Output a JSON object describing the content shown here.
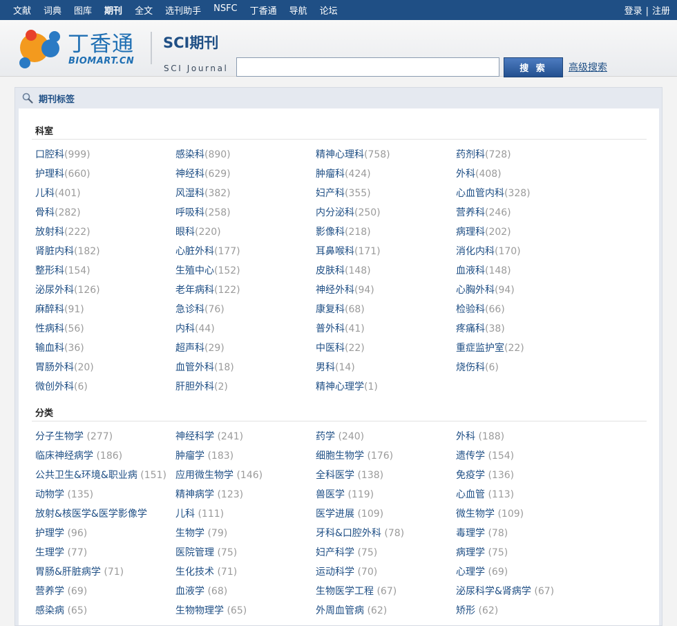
{
  "topnav": {
    "items": [
      "文献",
      "词典",
      "图库",
      "期刊",
      "全文",
      "选刊助手",
      "NSFC",
      "丁香通",
      "导航",
      "论坛"
    ],
    "active": "期刊",
    "login": "登录",
    "separator": "|",
    "register": "注册"
  },
  "header": {
    "logo_text": "丁香通",
    "logo_sub": "BIOMART.CN",
    "sci_title": "SCI期刊",
    "sci_sub": "SCI Journal",
    "search_value": "",
    "search_button": "搜 索",
    "advanced_search": "高级搜索"
  },
  "panel": {
    "title": "期刊标签",
    "sections": [
      {
        "title": "科室",
        "entries": [
          [
            "口腔科",
            "(999)"
          ],
          [
            "感染科",
            "(890)"
          ],
          [
            "精神心理科",
            "(758)"
          ],
          [
            "药剂科",
            "(728)"
          ],
          [
            "护理科",
            "(660)"
          ],
          [
            "神经科",
            "(629)"
          ],
          [
            "肿瘤科",
            "(424)"
          ],
          [
            "外科",
            "(408)"
          ],
          [
            "儿科",
            "(401)"
          ],
          [
            "风湿科",
            "(382)"
          ],
          [
            "妇产科",
            "(355)"
          ],
          [
            "心血管内科",
            "(328)"
          ],
          [
            "骨科",
            "(282)"
          ],
          [
            "呼吸科",
            "(258)"
          ],
          [
            "内分泌科",
            "(250)"
          ],
          [
            "营养科",
            "(246)"
          ],
          [
            "放射科",
            "(222)"
          ],
          [
            "眼科",
            "(220)"
          ],
          [
            "影像科",
            "(218)"
          ],
          [
            "病理科",
            "(202)"
          ],
          [
            "肾脏内科",
            "(182)"
          ],
          [
            "心脏外科",
            "(177)"
          ],
          [
            "耳鼻喉科",
            "(171)"
          ],
          [
            "消化内科",
            "(170)"
          ],
          [
            "整形科",
            "(154)"
          ],
          [
            "生殖中心",
            "(152)"
          ],
          [
            "皮肤科",
            "(148)"
          ],
          [
            "血液科",
            "(148)"
          ],
          [
            "泌尿外科",
            "(126)"
          ],
          [
            "老年病科",
            "(122)"
          ],
          [
            "神经外科",
            "(94)"
          ],
          [
            "心胸外科",
            "(94)"
          ],
          [
            "麻醉科",
            "(91)"
          ],
          [
            "急诊科",
            "(76)"
          ],
          [
            "康复科",
            "(68)"
          ],
          [
            "检验科",
            "(66)"
          ],
          [
            "性病科",
            "(56)"
          ],
          [
            "内科",
            "(44)"
          ],
          [
            "普外科",
            "(41)"
          ],
          [
            "疼痛科",
            "(38)"
          ],
          [
            "输血科",
            "(36)"
          ],
          [
            "超声科",
            "(29)"
          ],
          [
            "中医科",
            "(22)"
          ],
          [
            "重症监护室",
            "(22)"
          ],
          [
            "胃肠外科",
            "(20)"
          ],
          [
            "血管外科",
            "(18)"
          ],
          [
            "男科",
            "(14)"
          ],
          [
            "烧伤科",
            "(6)"
          ],
          [
            "微创外科",
            "(6)"
          ],
          [
            "肝胆外科",
            "(2)"
          ],
          [
            "精神心理学",
            "(1)"
          ]
        ]
      },
      {
        "title": "分类",
        "entries": [
          [
            "分子生物学",
            " (277)"
          ],
          [
            "神经科学",
            " (241)"
          ],
          [
            "药学",
            " (240)"
          ],
          [
            "外科",
            " (188)"
          ],
          [
            "临床神经病学",
            " (186)"
          ],
          [
            "肿瘤学",
            " (183)"
          ],
          [
            "细胞生物学",
            " (176)"
          ],
          [
            "遗传学",
            " (154)"
          ],
          [
            "公共卫生&环境&职业病",
            " (151)"
          ],
          [
            "应用微生物学",
            " (146)"
          ],
          [
            "全科医学",
            " (138)"
          ],
          [
            "免疫学",
            " (136)"
          ],
          [
            "动物学",
            " (135)"
          ],
          [
            "精神病学",
            " (123)"
          ],
          [
            "兽医学",
            " (119)"
          ],
          [
            "心血管",
            " (113)"
          ],
          [
            "放射&核医学&医学影像学",
            ""
          ],
          [
            "儿科",
            " (111)"
          ],
          [
            "医学进展",
            " (109)"
          ],
          [
            "微生物学",
            " (109)"
          ],
          [
            "护理学",
            " (96)"
          ],
          [
            "生物学",
            " (79)"
          ],
          [
            "牙科&口腔外科",
            " (78)"
          ],
          [
            "毒理学",
            " (78)"
          ],
          [
            "生理学",
            " (77)"
          ],
          [
            "医院管理",
            " (75)"
          ],
          [
            "妇产科学",
            " (75)"
          ],
          [
            "病理学",
            " (75)"
          ],
          [
            "胃肠&肝脏病学",
            " (71)"
          ],
          [
            "生化技术",
            " (71)"
          ],
          [
            "运动科学",
            " (70)"
          ],
          [
            "心理学",
            " (69)"
          ],
          [
            "营养学",
            " (69)"
          ],
          [
            "血液学",
            " (68)"
          ],
          [
            "生物医学工程",
            " (67)"
          ],
          [
            "泌尿科学&肾病学",
            " (67)"
          ],
          [
            "感染病",
            " (65)"
          ],
          [
            "生物物理学",
            " (65)"
          ],
          [
            "外周血管病",
            " (62)"
          ],
          [
            "矫形",
            " (62)"
          ]
        ]
      }
    ]
  }
}
